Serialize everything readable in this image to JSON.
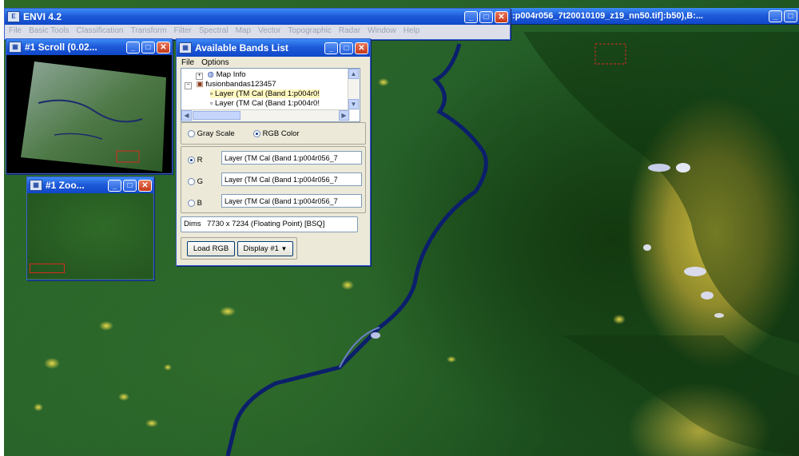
{
  "main": {
    "title": "ENVI 4.2",
    "menu": [
      "File",
      "Basic Tools",
      "Classification",
      "Transform",
      "Filter",
      "Spectral",
      "Map",
      "Vector",
      "Topographic",
      "Radar",
      "Window",
      "Help"
    ]
  },
  "image_window": {
    "title": ":p004r056_7t20010109_z19_nn50.tif]:b50),B:..."
  },
  "scroll_window": {
    "title": "#1 Scroll (0.02..."
  },
  "zoom_window": {
    "title": "#1 Zoo..."
  },
  "bands_window": {
    "title": "Available Bands List",
    "menu": [
      "File",
      "Options"
    ],
    "tree": {
      "map_info": "Map Info",
      "file": "fusionbandas123457",
      "layers": [
        "Layer (TM Cal (Band 1:p004r0!",
        "Layer (TM Cal (Band 1:p004r0!"
      ]
    },
    "mode": {
      "gray": "Gray Scale",
      "rgb": "RGB Color",
      "selected": "rgb"
    },
    "channels": [
      {
        "label": "R",
        "value": "Layer (TM Cal (Band 1:p004r056_7",
        "selected": true
      },
      {
        "label": "G",
        "value": "Layer (TM Cal (Band 1:p004r056_7",
        "selected": false
      },
      {
        "label": "B",
        "value": "Layer (TM Cal (Band 1:p004r056_7",
        "selected": false
      }
    ],
    "dims": {
      "label": "Dims",
      "value": "7730 x 7234 (Floating Point) [BSQ]"
    },
    "load_button": "Load RGB",
    "display_select": "Display #1"
  },
  "icons": [
    "envi-app-icon",
    "minimize-icon",
    "maximize-icon",
    "close-icon",
    "expand-icon",
    "collapse-icon",
    "globe-icon",
    "file-icon"
  ],
  "colors": {
    "titlebar": "#0f47c8",
    "close": "#c5391a",
    "river": "#0b1f6b",
    "vegetation": "#2d6a28",
    "highlands": "#c9b93a"
  }
}
